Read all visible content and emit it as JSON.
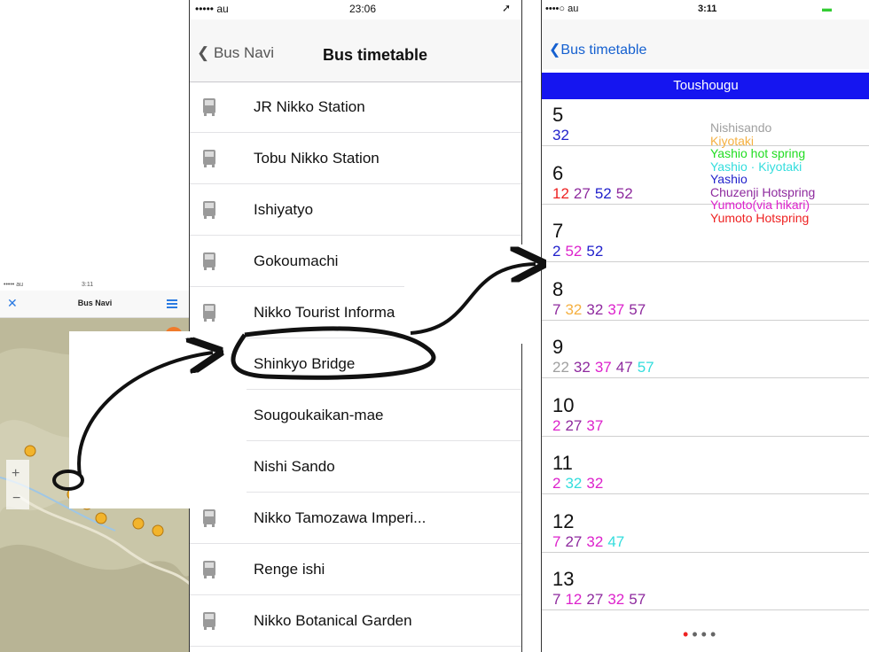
{
  "map_screen": {
    "status_carrier": "••••• au",
    "status_time": "3:11",
    "nav_title": "Bus Navi",
    "zoom_in": "+",
    "zoom_out": "−",
    "close_label": "✕"
  },
  "list_screen": {
    "status_carrier": "••••• au",
    "status_time": "23:06",
    "back_label": "Bus Navi",
    "title": "Bus timetable",
    "stops": [
      {
        "label": "JR Nikko Station",
        "icon": true
      },
      {
        "label": "Tobu Nikko Station",
        "icon": true
      },
      {
        "label": "Ishiyatyo",
        "icon": true
      },
      {
        "label": "Gokoumachi",
        "icon": true
      },
      {
        "label": "Nikko Tourist Informa",
        "icon": true
      },
      {
        "label": "Shinkyo Bridge",
        "icon": false
      },
      {
        "label": "Sougoukaikan-mae",
        "icon": false
      },
      {
        "label": "Nishi Sando",
        "icon": false
      },
      {
        "label": "Nikko Tamozawa Imperi...",
        "icon": true
      },
      {
        "label": "Renge ishi",
        "icon": true
      },
      {
        "label": "Nikko Botanical Garden",
        "icon": true
      }
    ]
  },
  "timetable_screen": {
    "status_carrier": "••••○ au",
    "status_time": "3:11",
    "back_label": "Bus timetable",
    "stop_name": "Toushougu",
    "colors": {
      "Nishisando": "#a0a0a0",
      "Kiyotaki": "#f5b041",
      "Yashio hot spring": "#22dd22",
      "Yashio · Kiyotaki": "#33dddd",
      "Yashio": "#2222cc",
      "Chuzenji Hotspring": "#8e2a9e",
      "Yumoto(via hikari)": "#dd22cc",
      "Yumoto Hotspring": "#ee2222"
    },
    "legend": [
      "Nishisando",
      "Kiyotaki",
      "Yashio hot spring",
      "Yashio · Kiyotaki",
      "Yashio",
      "Chuzenji Hotspring",
      "Yumoto(via hikari)",
      "Yumoto Hotspring"
    ],
    "hours": [
      {
        "hour": "5",
        "minutes": [
          {
            "m": "32",
            "c": "#2222cc"
          }
        ]
      },
      {
        "hour": "6",
        "minutes": [
          {
            "m": "12",
            "c": "#ee2222"
          },
          {
            "m": "27",
            "c": "#8e2a9e"
          },
          {
            "m": "52",
            "c": "#2222cc"
          },
          {
            "m": "52",
            "c": "#8e2a9e"
          }
        ]
      },
      {
        "hour": "7",
        "minutes": [
          {
            "m": "2",
            "c": "#2222cc"
          },
          {
            "m": "52",
            "c": "#dd22cc"
          },
          {
            "m": "52",
            "c": "#2222cc"
          }
        ]
      },
      {
        "hour": "8",
        "minutes": [
          {
            "m": "7",
            "c": "#8e2a9e"
          },
          {
            "m": "32",
            "c": "#f5b041"
          },
          {
            "m": "32",
            "c": "#8e2a9e"
          },
          {
            "m": "37",
            "c": "#dd22cc"
          },
          {
            "m": "57",
            "c": "#8e2a9e"
          }
        ]
      },
      {
        "hour": "9",
        "minutes": [
          {
            "m": "22",
            "c": "#a0a0a0"
          },
          {
            "m": "32",
            "c": "#8e2a9e"
          },
          {
            "m": "37",
            "c": "#dd22cc"
          },
          {
            "m": "47",
            "c": "#8e2a9e"
          },
          {
            "m": "57",
            "c": "#33dddd"
          }
        ]
      },
      {
        "hour": "10",
        "minutes": [
          {
            "m": "2",
            "c": "#dd22cc"
          },
          {
            "m": "27",
            "c": "#8e2a9e"
          },
          {
            "m": "37",
            "c": "#dd22cc"
          }
        ]
      },
      {
        "hour": "11",
        "minutes": [
          {
            "m": "2",
            "c": "#dd22cc"
          },
          {
            "m": "32",
            "c": "#33dddd"
          },
          {
            "m": "32",
            "c": "#dd22cc"
          }
        ]
      },
      {
        "hour": "12",
        "minutes": [
          {
            "m": "7",
            "c": "#dd22cc"
          },
          {
            "m": "27",
            "c": "#8e2a9e"
          },
          {
            "m": "32",
            "c": "#dd22cc"
          },
          {
            "m": "47",
            "c": "#33dddd"
          }
        ]
      },
      {
        "hour": "13",
        "minutes": [
          {
            "m": "7",
            "c": "#8e2a9e"
          },
          {
            "m": "12",
            "c": "#dd22cc"
          },
          {
            "m": "27",
            "c": "#8e2a9e"
          },
          {
            "m": "32",
            "c": "#dd22cc"
          },
          {
            "m": "57",
            "c": "#8e2a9e"
          }
        ]
      }
    ],
    "page_dots": 4
  }
}
